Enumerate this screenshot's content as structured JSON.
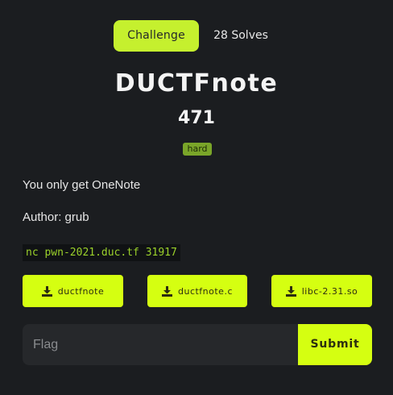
{
  "tabs": {
    "challenge_label": "Challenge",
    "solves_label": "28 Solves"
  },
  "challenge": {
    "name": "DUCTFnote",
    "points": "471",
    "difficulty": "hard",
    "description": "You only get OneNote",
    "author": "Author: grub",
    "connection": "nc pwn-2021.duc.tf 31917"
  },
  "files": [
    {
      "label": "ductfnote",
      "icon": "download-icon"
    },
    {
      "label": "ductfnote.c",
      "icon": "download-icon"
    },
    {
      "label": "libc-2.31.so",
      "icon": "download-icon"
    }
  ],
  "flag_form": {
    "placeholder": "Flag",
    "value": "",
    "submit_label": "Submit"
  },
  "colors": {
    "background": "#1b1d20",
    "accent": "#d5ff11",
    "tab_active": "#c5f02e",
    "badge": "#7aa529",
    "code_text": "#9bd12b",
    "input_bg": "#26282b"
  }
}
